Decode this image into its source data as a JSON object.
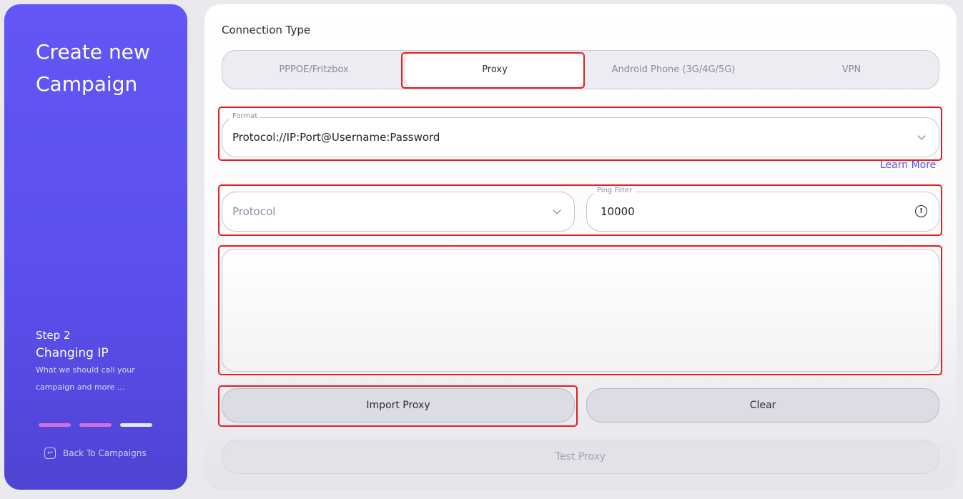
{
  "sidebar": {
    "title": "Create new Campaign",
    "step_label": "Step 2",
    "step_title": "Changing IP",
    "step_description": "What we should call your campaign and more ...",
    "progress_colors": [
      "#d16ee0",
      "#d16ee0",
      "#e6e6ee"
    ],
    "back_icon": "back-arrow-icon",
    "back_label": "Back To Campaigns"
  },
  "main": {
    "connection_type_label": "Connection Type",
    "tabs": [
      {
        "label": "PPPOE/Fritzbox",
        "active": false
      },
      {
        "label": "Proxy",
        "active": true
      },
      {
        "label": "Android Phone (3G/4G/5G)",
        "active": false
      },
      {
        "label": "VPN",
        "active": false
      }
    ],
    "format": {
      "legend": "Format",
      "value": "Protocol://IP:Port@Username:Password"
    },
    "learn_more": "Learn More",
    "protocol": {
      "placeholder": "Protocol"
    },
    "ping_filter": {
      "legend": "Ping Filter",
      "value": "10000",
      "icon": "info-icon"
    },
    "proxy_list": {
      "value": ""
    },
    "buttons": {
      "import": "Import Proxy",
      "clear": "Clear",
      "test": "Test Proxy"
    }
  },
  "colors": {
    "sidebar_bg": "#5b50ee",
    "accent": "#5a4fe0",
    "highlight_box": "#e41e1e"
  }
}
